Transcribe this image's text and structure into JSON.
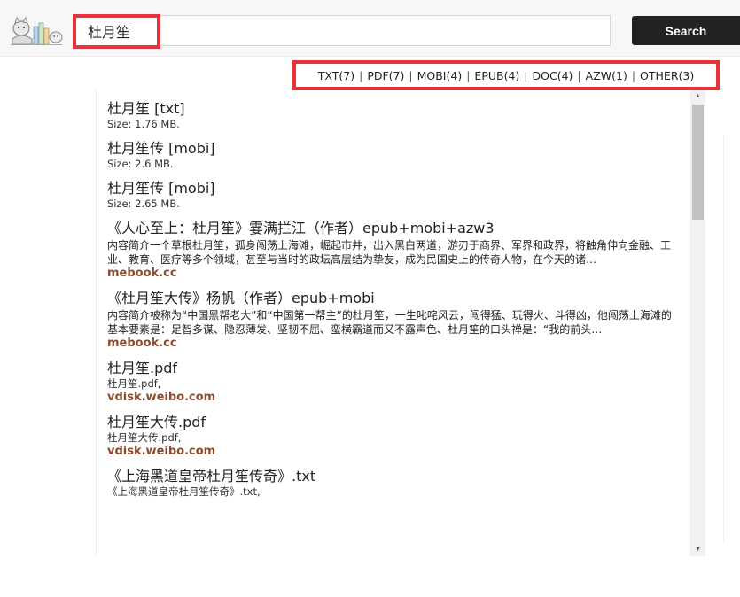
{
  "search": {
    "query": "杜月笙",
    "button_label": "Search"
  },
  "filters": [
    {
      "label": "TXT(7)"
    },
    {
      "label": "PDF(7)"
    },
    {
      "label": "MOBI(4)"
    },
    {
      "label": "EPUB(4)"
    },
    {
      "label": "DOC(4)"
    },
    {
      "label": "AZW(1)"
    },
    {
      "label": "OTHER(3)"
    }
  ],
  "filter_separator": "|",
  "results": [
    {
      "title": "杜月笙 [txt]",
      "meta": "Size: 1.76 MB."
    },
    {
      "title": "杜月笙传 [mobi]",
      "meta": "Size: 2.6 MB."
    },
    {
      "title": "杜月笙传 [mobi]",
      "meta": "Size: 2.65 MB."
    },
    {
      "title": "《人心至上：杜月笙》霎满拦江（作者）epub+mobi+azw3",
      "desc": "内容简介一个草根杜月笙，孤身闯荡上海滩，崛起市井，出入黑白两道，游刃于商界、军界和政界，将触角伸向金融、工业、教育、医疗等多个领域，甚至与当时的政坛高层结为挚友，成为民国史上的传奇人物，在今天的诸…",
      "source": "mebook.cc"
    },
    {
      "title": "《杜月笙大传》杨帆（作者）epub+mobi",
      "desc": "内容简介被称为“中国黑帮老大”和“中国第一帮主”的杜月笙，一生叱咤风云，闯得猛、玩得火、斗得凶，他闯荡上海滩的基本要素是：足智多谋、隐忍薄发、坚韧不屈、蛮横霸道而又不露声色、杜月笙的口头禅是：“我的前头…",
      "source": "mebook.cc"
    },
    {
      "title": "杜月笙.pdf",
      "meta": "杜月笙.pdf,",
      "source": "vdisk.weibo.com"
    },
    {
      "title": "杜月笙大传.pdf",
      "meta": "杜月笙大传.pdf,",
      "source": "vdisk.weibo.com"
    },
    {
      "title": "《上海黑道皇帝杜月笙传奇》.txt",
      "meta": "《上海黑道皇帝杜月笙传奇》.txt,"
    }
  ],
  "colors": {
    "highlight": "#e8313a",
    "source_link": "#8b4a2b",
    "button_bg": "#222222"
  },
  "icons": {
    "logo": "logo-icon",
    "arrow": "annotation-arrow",
    "scroll_up": "scroll-up-icon",
    "scroll_down": "scroll-down-icon"
  }
}
